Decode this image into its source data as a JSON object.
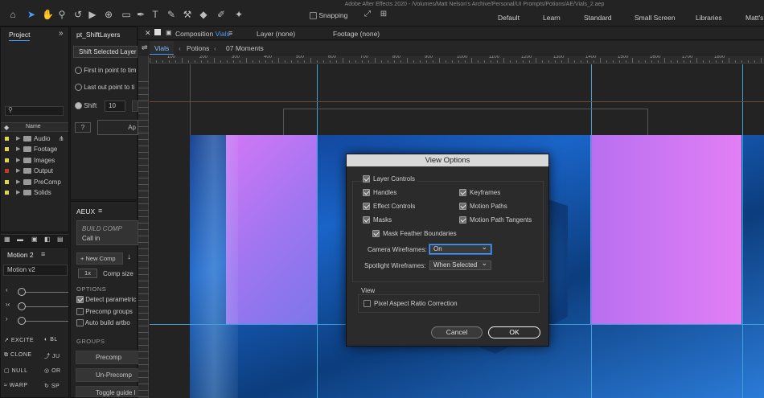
{
  "window_title": "Adobe After Effects 2020 - /Volumes/Matt Nelson's Archive/Personal/UI Prompts/Potions/AE/Vials_2.aep",
  "toolbar": {
    "snapping_label": "Snapping",
    "workspaces": [
      "Default",
      "Learn",
      "Standard",
      "Small Screen",
      "Libraries",
      "Matt's"
    ]
  },
  "project_panel": {
    "tab": "Project",
    "search_icon": "search-icon",
    "column_name": "Name",
    "items": [
      {
        "name": "Audio",
        "color": "#e3d548"
      },
      {
        "name": "Footage",
        "color": "#e3d548"
      },
      {
        "name": "Images",
        "color": "#e3d548"
      },
      {
        "name": "Output",
        "color": "#c1392b"
      },
      {
        "name": "PreComp",
        "color": "#e3d548"
      },
      {
        "name": "Solids",
        "color": "#e3d548"
      }
    ]
  },
  "pt_panel": {
    "tab": "pt_ShiftLayers",
    "dropdown": "Shift Selected Layer",
    "radio1": "First in point to tim",
    "radio2": "Last out point to ti",
    "shift_label": "Shift",
    "shift_value": "10",
    "help": "?",
    "apply": "Ap"
  },
  "aeux_panel": {
    "tab": "AEUX",
    "build_title": "BUILD COMP",
    "build_sub": "Call in",
    "new_comp": "New Comp",
    "comp_size_mult": "1x",
    "comp_size_label": "Comp size",
    "options_header": "OPTIONS",
    "opt1": "Detect parametric",
    "opt2": "Precomp groups",
    "opt3": "Auto build artbo",
    "groups_header": "GROUPS",
    "precomp": "Precomp",
    "unprecomp": "Un-Precomp",
    "toggle_guide": "Toggle guide l"
  },
  "motion_panel": {
    "tab": "Motion 2",
    "dropdown": "Motion v2",
    "buttons": [
      "EXCITE",
      "BL",
      "CLONE",
      "JU",
      "NULL",
      "OR",
      "WARP",
      "SP"
    ]
  },
  "viewer": {
    "comp_tab_prefix": "Composition",
    "comp_name": "Vials",
    "layer_tab": "Layer (none)",
    "footage_tab": "Footage (none)",
    "breadcrumbs": [
      "Vials",
      "Potions",
      "07 Moments"
    ],
    "ruler_labels": [
      "100",
      "200",
      "300",
      "400",
      "500",
      "600",
      "700",
      "800",
      "900",
      "1000",
      "1100",
      "1200",
      "1300",
      "1400",
      "1500",
      "1600",
      "1700",
      "1800"
    ]
  },
  "dialog": {
    "title": "View Options",
    "layer_controls": "Layer Controls",
    "handles": "Handles",
    "keyframes": "Keyframes",
    "effect_controls": "Effect Controls",
    "motion_paths": "Motion Paths",
    "masks": "Masks",
    "motion_path_tangents": "Motion Path Tangents",
    "mask_feather": "Mask Feather Boundaries",
    "camera_label": "Camera Wireframes:",
    "camera_value": "On",
    "spotlight_label": "Spotlight Wireframes:",
    "spotlight_value": "When Selected",
    "view_header": "View",
    "pixel_aspect": "Pixel Aspect Ratio Correction",
    "cancel": "Cancel",
    "ok": "OK"
  }
}
